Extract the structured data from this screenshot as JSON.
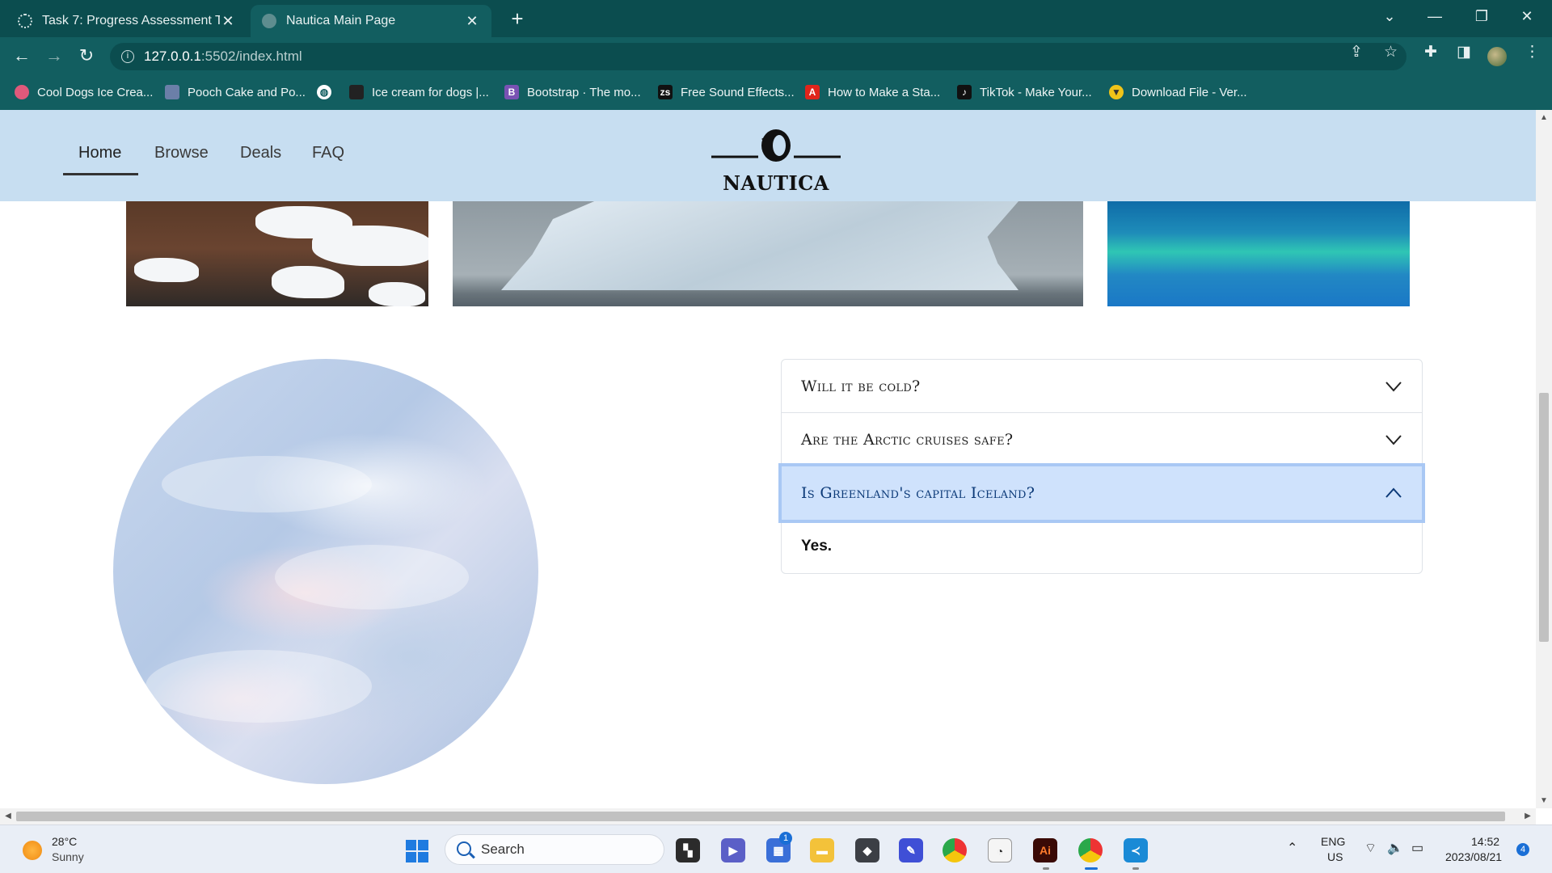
{
  "browser": {
    "tabs": [
      {
        "title": "Task 7: Progress Assessment Two",
        "active": false
      },
      {
        "title": "Nautica Main Page",
        "active": true
      }
    ],
    "new_tab_icon": "plus-icon",
    "url_host": "127.0.0.1",
    "url_path": ":5502/index.html",
    "bookmarks": [
      {
        "label": "Cool Dogs Ice Crea...",
        "icon": "dog-icon",
        "color": "#e0597b"
      },
      {
        "label": "Pooch Cake and Po...",
        "icon": "pooch-icon",
        "color": "#6b7fa8"
      },
      {
        "label": "",
        "icon": "globe-icon",
        "color": "#ffffff"
      },
      {
        "label": "Ice cream for dogs |...",
        "icon": "site-icon",
        "color": "#222222"
      },
      {
        "label": "Bootstrap · The mo...",
        "icon": "bootstrap-icon",
        "color": "#7952b3"
      },
      {
        "label": "Free Sound Effects...",
        "icon": "zapsplat-icon",
        "color": "#111111"
      },
      {
        "label": "How to Make a Sta...",
        "icon": "adobe-icon",
        "color": "#e0251b"
      },
      {
        "label": "TikTok - Make Your...",
        "icon": "tiktok-icon",
        "color": "#111111"
      },
      {
        "label": "Download File - Ver...",
        "icon": "download-icon",
        "color": "#f0c419"
      }
    ]
  },
  "site": {
    "nav": [
      {
        "label": "Home",
        "active": true
      },
      {
        "label": "Browse",
        "active": false
      },
      {
        "label": "Deals",
        "active": false
      },
      {
        "label": "FAQ",
        "active": false
      }
    ],
    "logo_text": "NAUTICA",
    "accent_color": "#c7def1",
    "faq": [
      {
        "question": "Will it be cold?",
        "open": false
      },
      {
        "question": "Are the Arctic cruises safe?",
        "open": false
      },
      {
        "question": "Is Greenland's capital Iceland?",
        "open": true,
        "answer": "Yes."
      }
    ]
  },
  "taskbar": {
    "weather_temp": "28°C",
    "weather_condition": "Sunny",
    "search_placeholder": "Search",
    "lang": "ENG",
    "region": "US",
    "time": "14:52",
    "date": "2023/08/21",
    "notification_count": "4",
    "store_badge": "1"
  }
}
